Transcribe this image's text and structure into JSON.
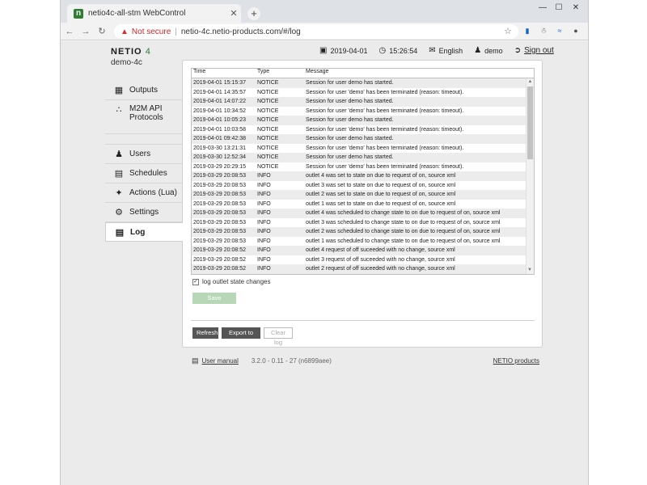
{
  "browser": {
    "tab_title": "netio4c-all-stm WebControl",
    "tab_favicon": "n",
    "new_tab": "+",
    "not_secure": "Not secure",
    "url": "netio-4c.netio-products.com/#/log",
    "min": "—",
    "max": "☐",
    "close": "✕"
  },
  "brand": {
    "logo": "NETIO",
    "logo_suffix": "4",
    "device": "demo-4c",
    "accent_color": "#2e7d32"
  },
  "header": {
    "date": "2019-04-01",
    "time": "15:26:54",
    "language": "English",
    "user": "demo",
    "signout": "Sign out"
  },
  "sidebar": {
    "items": [
      {
        "label": "Outputs",
        "icon": "outputs-icon"
      },
      {
        "label": "M2M API",
        "label2": "Protocols",
        "icon": "m2m-icon"
      },
      {
        "label": "Users",
        "icon": "user-icon"
      },
      {
        "label": "Schedules",
        "icon": "schedule-icon"
      },
      {
        "label": "Actions (Lua)",
        "icon": "actions-icon"
      },
      {
        "label": "Settings",
        "icon": "gear-icon"
      },
      {
        "label": "Log",
        "icon": "log-icon"
      }
    ]
  },
  "log": {
    "columns": {
      "time": "Time",
      "type": "Type",
      "message": "Message"
    },
    "rows": [
      {
        "time": "2019-04-01 15:15:37",
        "type": "NOTICE",
        "message": "Session for user demo has started."
      },
      {
        "time": "2019-04-01 14:35:57",
        "type": "NOTICE",
        "message": "Session for user 'demo' has been terminated (reason: timeout)."
      },
      {
        "time": "2019-04-01 14:07:22",
        "type": "NOTICE",
        "message": "Session for user demo has started."
      },
      {
        "time": "2019-04-01 10:34:52",
        "type": "NOTICE",
        "message": "Session for user 'demo' has been terminated (reason: timeout)."
      },
      {
        "time": "2019-04-01 10:05:23",
        "type": "NOTICE",
        "message": "Session for user demo has started."
      },
      {
        "time": "2019-04-01 10:03:58",
        "type": "NOTICE",
        "message": "Session for user 'demo' has been terminated (reason: timeout)."
      },
      {
        "time": "2019-04-01 09:42:38",
        "type": "NOTICE",
        "message": "Session for user demo has started."
      },
      {
        "time": "2019-03-30 13:21:31",
        "type": "NOTICE",
        "message": "Session for user 'demo' has been terminated (reason: timeout)."
      },
      {
        "time": "2019-03-30 12:52:34",
        "type": "NOTICE",
        "message": "Session for user demo has started."
      },
      {
        "time": "2019-03-29 20:29:15",
        "type": "NOTICE",
        "message": "Session for user 'demo' has been terminated (reason: timeout)."
      },
      {
        "time": "2019-03-29 20:08:53",
        "type": "INFO",
        "message": "outlet 4 was set to state on due to request of on, source xml"
      },
      {
        "time": "2019-03-29 20:08:53",
        "type": "INFO",
        "message": "outlet 3 was set to state on due to request of on, source xml"
      },
      {
        "time": "2019-03-29 20:08:53",
        "type": "INFO",
        "message": "outlet 2 was set to state on due to request of on, source xml"
      },
      {
        "time": "2019-03-29 20:08:53",
        "type": "INFO",
        "message": "outlet 1 was set to state on due to request of on, source xml"
      },
      {
        "time": "2019-03-29 20:08:53",
        "type": "INFO",
        "message": "outlet 4 was scheduled to change state to on due to request of on, source xml"
      },
      {
        "time": "2019-03-29 20:08:53",
        "type": "INFO",
        "message": "outlet 3 was scheduled to change state to on due to request of on, source xml"
      },
      {
        "time": "2019-03-29 20:08:53",
        "type": "INFO",
        "message": "outlet 2 was scheduled to change state to on due to request of on, source xml"
      },
      {
        "time": "2019-03-29 20:08:53",
        "type": "INFO",
        "message": "outlet 1 was scheduled to change state to on due to request of on, source xml"
      },
      {
        "time": "2019-03-29 20:08:52",
        "type": "INFO",
        "message": "outlet 4 request of off suceeded with no change, source xml"
      },
      {
        "time": "2019-03-29 20:08:52",
        "type": "INFO",
        "message": "outlet 3 request of off suceeded with no change, source xml"
      },
      {
        "time": "2019-03-29 20:08:52",
        "type": "INFO",
        "message": "outlet 2 request of off suceeded with no change, source xml"
      }
    ],
    "checkbox_label": "log outlet state changes",
    "checkbox_checked": true,
    "save_label": "Save Changes",
    "refresh_label": "Refresh",
    "export_label": "Export to file",
    "clear_label": "Clear log"
  },
  "footer": {
    "manual": "User manual",
    "version": "3.2.0 - 0.11 - 27 (n6899aee)",
    "products": "NETIO products"
  }
}
